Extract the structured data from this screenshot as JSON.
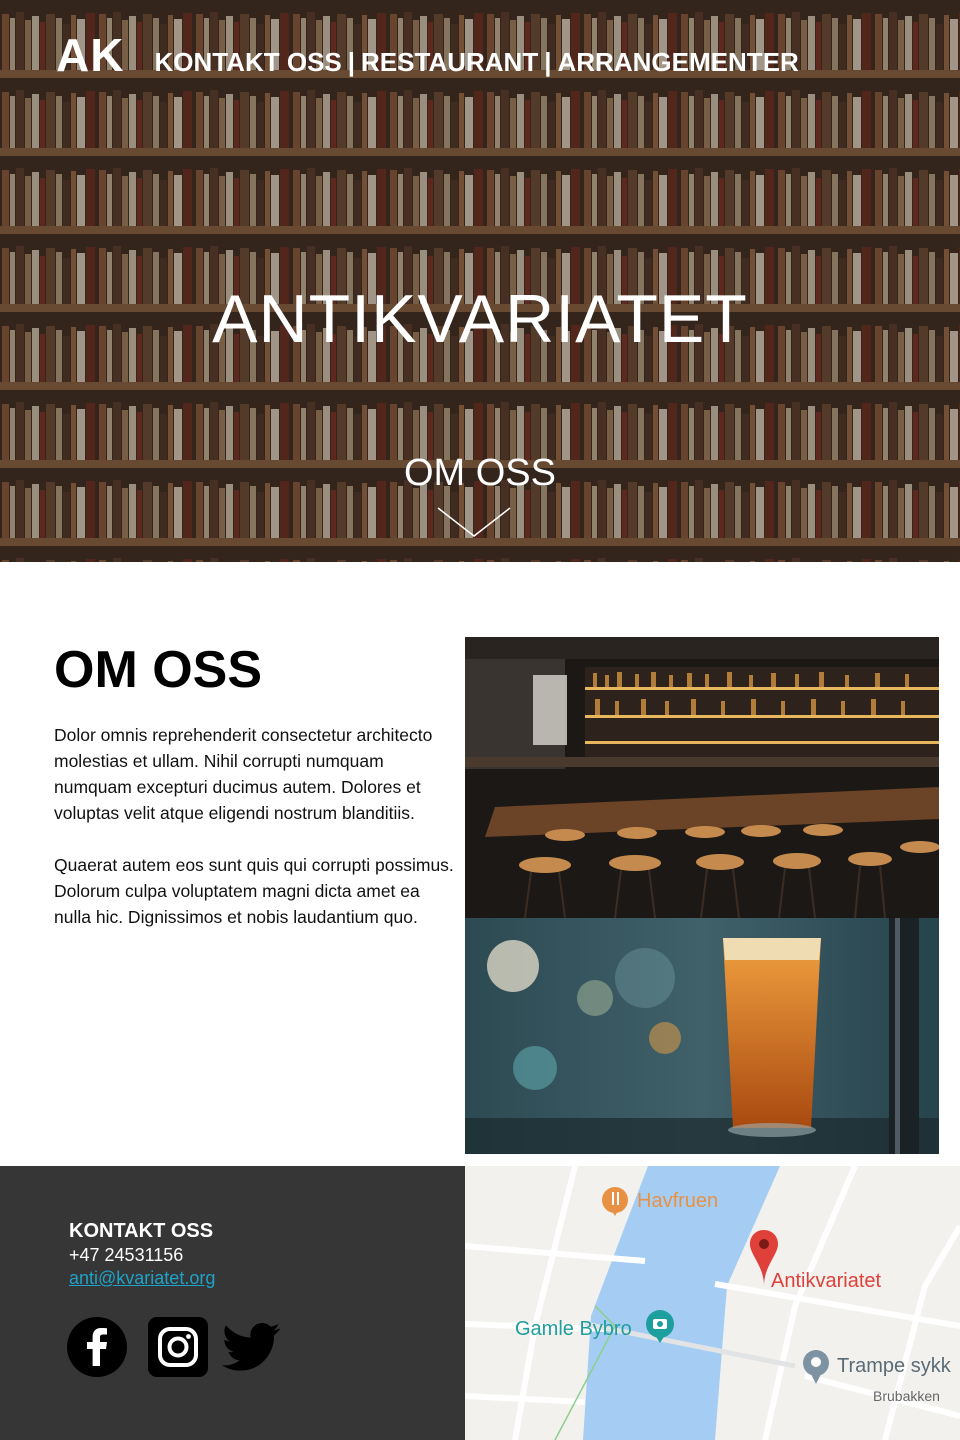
{
  "nav": {
    "logo": "AK",
    "links": [
      "KONTAKT OSS",
      "RESTAURANT",
      "ARRANGEMENTER"
    ],
    "separator": "|"
  },
  "hero": {
    "title": "ANTIKVARIATET",
    "subtitle": "OM OSS",
    "scroll_icon": "chevron-down-icon"
  },
  "about": {
    "heading": "OM OSS",
    "paragraphs": [
      "Dolor omnis reprehenderit consectetur architecto molestias et ullam. Nihil corrupti numquam numquam excepturi ducimus autem. Dolores et voluptas velit atque eligendi nostrum blanditiis.",
      "Quaerat autem eos sunt quis qui corrupti possimus. Dolorum culpa voluptatem magni dicta amet ea nulla hic. Dignissimos et nobis laudantium quo."
    ]
  },
  "contact": {
    "title": "KONTAKT OSS",
    "phone": "+47 24531156",
    "email": "anti@kvariatet.org",
    "social": [
      "facebook-icon",
      "instagram-icon",
      "twitter-icon"
    ]
  },
  "map": {
    "places": {
      "restaurant": "Havfruen",
      "main": "Antikvariatet",
      "landmark": "Gamle Bybro",
      "shop": "Trampe sykk",
      "street": "Brubakken"
    }
  },
  "colors": {
    "footer_bg": "#363636",
    "link": "#1fa2c8",
    "map_pin": "#e0403a",
    "map_water": "#9fcbf5",
    "map_orange": "#e89145",
    "map_teal": "#1f9e9e"
  }
}
